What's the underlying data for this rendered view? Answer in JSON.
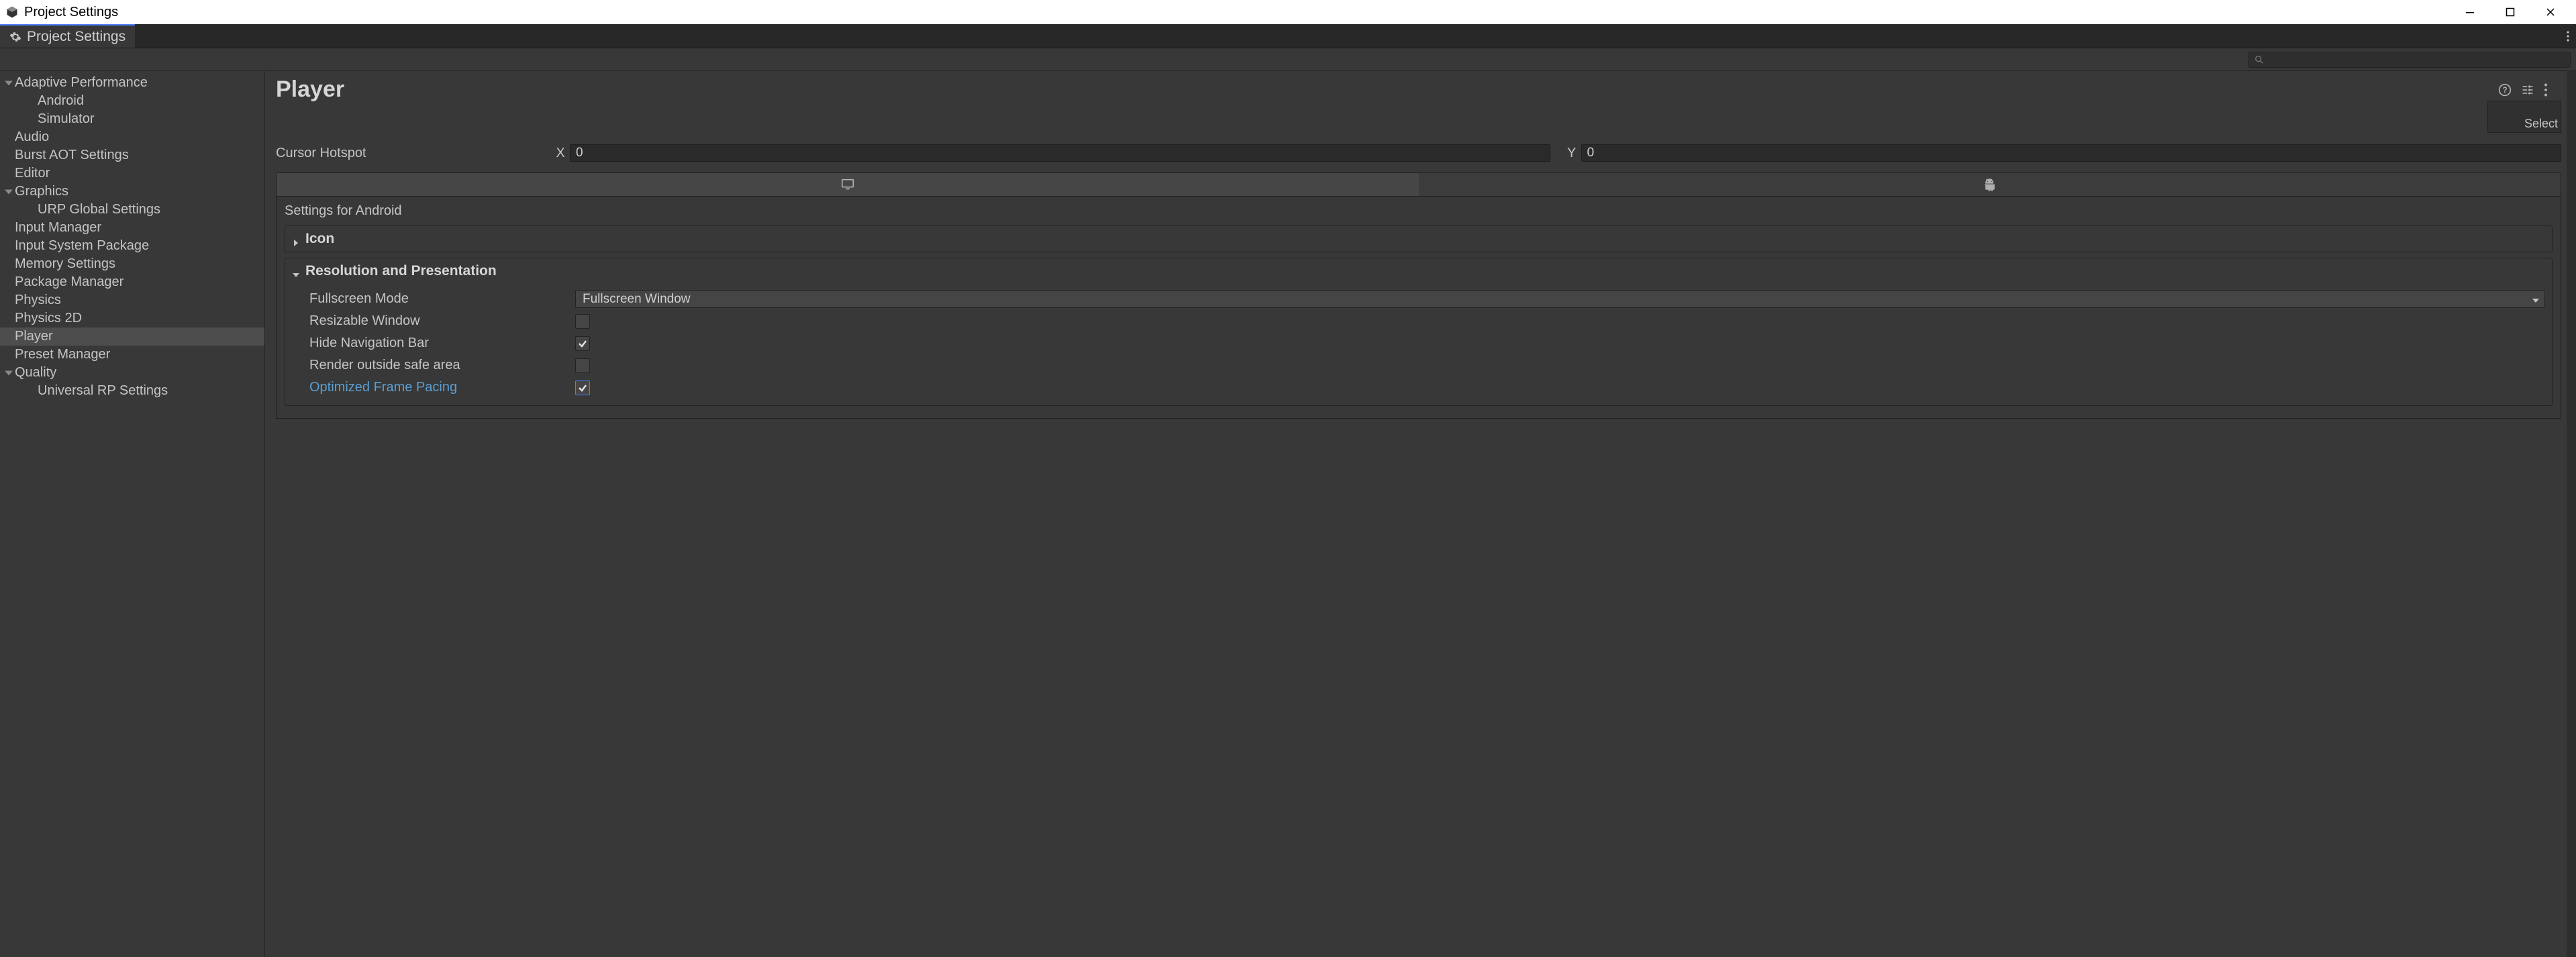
{
  "window": {
    "title": "Project Settings"
  },
  "tab": {
    "label": "Project Settings"
  },
  "search": {
    "placeholder": ""
  },
  "sidebar": {
    "items": [
      {
        "label": "Adaptive Performance",
        "fold": "open",
        "depth": 0
      },
      {
        "label": "Android",
        "fold": "none",
        "depth": 1
      },
      {
        "label": "Simulator",
        "fold": "none",
        "depth": 1
      },
      {
        "label": "Audio",
        "fold": "none",
        "depth": 0
      },
      {
        "label": "Burst AOT Settings",
        "fold": "none",
        "depth": 0
      },
      {
        "label": "Editor",
        "fold": "none",
        "depth": 0
      },
      {
        "label": "Graphics",
        "fold": "open",
        "depth": 0
      },
      {
        "label": "URP Global Settings",
        "fold": "none",
        "depth": 1
      },
      {
        "label": "Input Manager",
        "fold": "none",
        "depth": 0
      },
      {
        "label": "Input System Package",
        "fold": "none",
        "depth": 0
      },
      {
        "label": "Memory Settings",
        "fold": "none",
        "depth": 0
      },
      {
        "label": "Package Manager",
        "fold": "none",
        "depth": 0
      },
      {
        "label": "Physics",
        "fold": "none",
        "depth": 0
      },
      {
        "label": "Physics 2D",
        "fold": "none",
        "depth": 0
      },
      {
        "label": "Player",
        "fold": "none",
        "depth": 0,
        "selected": true
      },
      {
        "label": "Preset Manager",
        "fold": "none",
        "depth": 0
      },
      {
        "label": "Quality",
        "fold": "open",
        "depth": 0
      },
      {
        "label": "Universal RP Settings",
        "fold": "none",
        "depth": 1
      }
    ]
  },
  "main": {
    "title": "Player",
    "select_label": "Select",
    "cursor_hotspot": {
      "label": "Cursor Hotspot",
      "x_label": "X",
      "x_value": "0",
      "y_label": "Y",
      "y_value": "0"
    },
    "platform_section_title": "Settings for Android",
    "foldouts": {
      "icon": {
        "label": "Icon",
        "open": false
      },
      "resolution": {
        "label": "Resolution and Presentation",
        "open": true,
        "fields": {
          "fullscreen_mode": {
            "label": "Fullscreen Mode",
            "value": "Fullscreen Window"
          },
          "resizable_window": {
            "label": "Resizable Window",
            "checked": false
          },
          "hide_nav_bar": {
            "label": "Hide Navigation Bar",
            "checked": true
          },
          "render_outside_safe": {
            "label": "Render outside safe area",
            "checked": false
          },
          "optimized_frame_pacing": {
            "label": "Optimized Frame Pacing",
            "checked": true
          }
        }
      }
    }
  }
}
